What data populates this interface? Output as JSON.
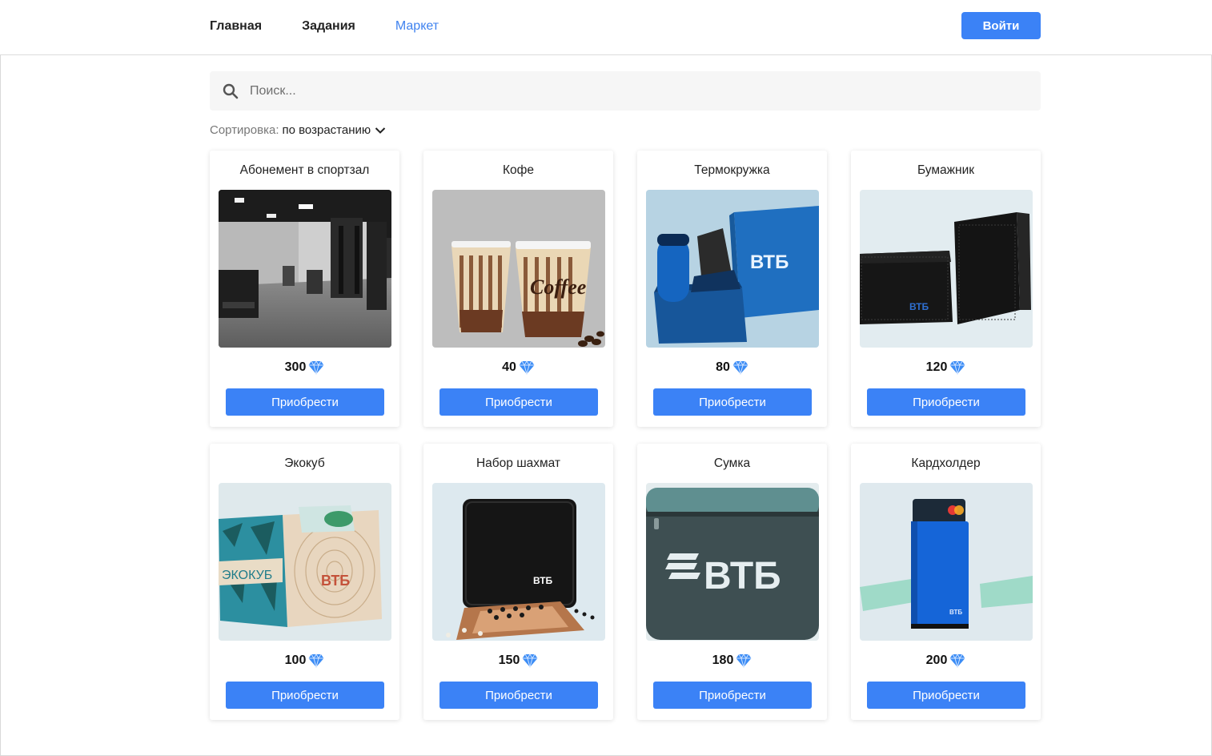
{
  "header": {
    "nav": [
      {
        "label": "Главная"
      },
      {
        "label": "Задания"
      },
      {
        "label": "Маркет"
      }
    ],
    "login_label": "Войти"
  },
  "search": {
    "placeholder": "Поиск..."
  },
  "sort": {
    "label": "Сортировка:",
    "value": "по возрастанию"
  },
  "colors": {
    "accent": "#3b82f6",
    "active_nav": "#3f82ef",
    "gem": "#3b8cf5"
  },
  "products": [
    {
      "title": "Абонемент в спортзал",
      "price": "300",
      "button": "Приобрести",
      "image": "gym-photo"
    },
    {
      "title": "Кофе",
      "price": "40",
      "button": "Приобрести",
      "image": "coffee-cups-photo"
    },
    {
      "title": "Термокружка",
      "price": "80",
      "button": "Приобрести",
      "image": "thermo-mug-gift-box-photo"
    },
    {
      "title": "Бумажник",
      "price": "120",
      "button": "Приобрести",
      "image": "wallet-photo"
    },
    {
      "title": "Экокуб",
      "price": "100",
      "button": "Приобрести",
      "image": "ecocube-photo"
    },
    {
      "title": "Набор шахмат",
      "price": "150",
      "button": "Приобрести",
      "image": "chess-set-photo"
    },
    {
      "title": "Сумка",
      "price": "180",
      "button": "Приобрести",
      "image": "bag-photo"
    },
    {
      "title": "Кардхолдер",
      "price": "200",
      "button": "Приобрести",
      "image": "cardholder-photo"
    }
  ],
  "image_text": {
    "coffee": "Coffee",
    "brand": "ВТБ",
    "ecocube": "ЭКОКУБ"
  }
}
